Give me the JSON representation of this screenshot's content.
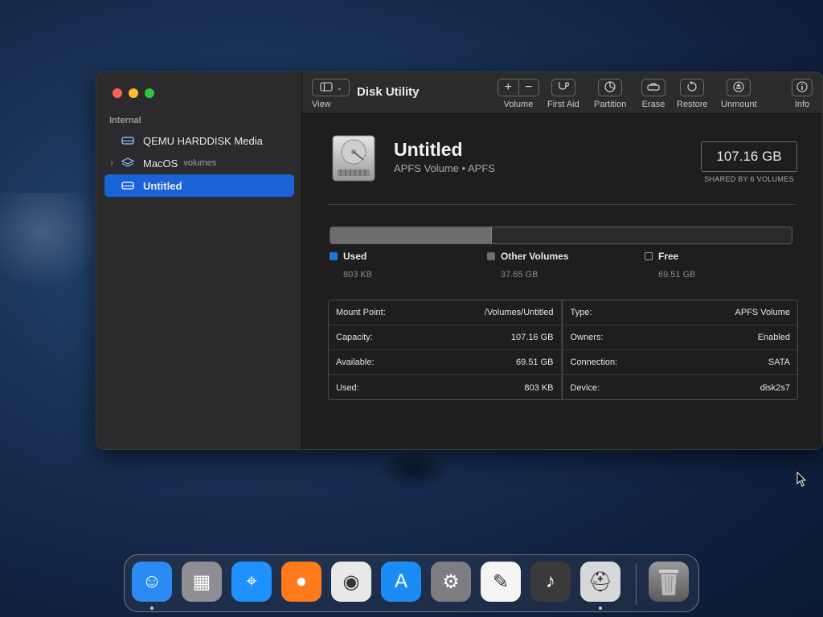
{
  "window": {
    "title": "Disk Utility"
  },
  "toolbar": {
    "view_label": "View",
    "volume_label": "Volume",
    "firstaid_label": "First Aid",
    "partition_label": "Partition",
    "erase_label": "Erase",
    "restore_label": "Restore",
    "unmount_label": "Unmount",
    "info_label": "Info"
  },
  "sidebar": {
    "section": "Internal",
    "items": [
      {
        "label": "QEMU HARDDISK Media",
        "icon": "disk-icon"
      },
      {
        "label": "MacOS",
        "sub": "volumes",
        "icon": "layers-icon"
      },
      {
        "label": "Untitled",
        "icon": "disk-icon"
      }
    ]
  },
  "volume": {
    "name": "Untitled",
    "subtitle": "APFS Volume • APFS",
    "capacity": "107.16 GB",
    "capacity_note": "SHARED BY 6 VOLUMES"
  },
  "usage": {
    "used_fraction": 0.35,
    "legend": [
      {
        "label": "Used",
        "value": "803 KB",
        "color": "#1d78d6"
      },
      {
        "label": "Other Volumes",
        "value": "37.65 GB",
        "color": "#6d6d6d"
      },
      {
        "label": "Free",
        "value": "69.51 GB",
        "color": "#1e1e1e"
      }
    ]
  },
  "info_left": [
    {
      "key": "Mount Point:",
      "value": "/Volumes/Untitled"
    },
    {
      "key": "Capacity:",
      "value": "107.16 GB"
    },
    {
      "key": "Available:",
      "value": "69.51 GB"
    },
    {
      "key": "Used:",
      "value": "803 KB"
    }
  ],
  "info_right": [
    {
      "key": "Type:",
      "value": "APFS Volume"
    },
    {
      "key": "Owners:",
      "value": "Enabled"
    },
    {
      "key": "Connection:",
      "value": "SATA"
    },
    {
      "key": "Device:",
      "value": "disk2s7"
    }
  ],
  "dock": [
    {
      "name": "finder-icon",
      "glyph": "☺",
      "color": "#2a8bf2",
      "running": true
    },
    {
      "name": "launchpad-icon",
      "glyph": "▦",
      "color": "#8e8e93",
      "running": false
    },
    {
      "name": "safari-icon",
      "glyph": "⌖",
      "color": "#1e90ff",
      "running": false
    },
    {
      "name": "firefox-icon",
      "glyph": "●",
      "color": "#ff7a1a",
      "running": false
    },
    {
      "name": "chrome-icon",
      "glyph": "◉",
      "color": "#e8e8e8",
      "running": false
    },
    {
      "name": "app-store-icon",
      "glyph": "A",
      "color": "#1c8cf5",
      "running": false
    },
    {
      "name": "system-preferences-icon",
      "glyph": "⚙",
      "color": "#7d7d82",
      "running": false
    },
    {
      "name": "textedit-icon",
      "glyph": "✎",
      "color": "#f4f4f4",
      "running": false
    },
    {
      "name": "garageband-icon",
      "glyph": "♪",
      "color": "#3a3a3a",
      "running": false
    },
    {
      "name": "disk-utility-icon",
      "glyph": "⛑",
      "color": "#d8d8d8",
      "running": true
    }
  ],
  "trash": {
    "name": "trash-icon",
    "glyph": "🗑"
  }
}
